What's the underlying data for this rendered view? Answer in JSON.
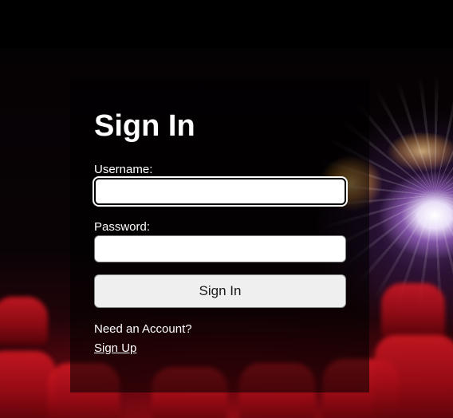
{
  "page": {
    "title": "Sign In"
  },
  "form": {
    "username_label": "Username:",
    "username_value": "",
    "password_label": "Password:",
    "password_value": "",
    "submit_label": "Sign In"
  },
  "footer": {
    "prompt": "Need an Account?",
    "signup_link": "Sign Up"
  },
  "theme": {
    "background": "#000000",
    "seat_red": "#c4121c",
    "text": "#ffffff",
    "button_bg": "#efefef"
  }
}
